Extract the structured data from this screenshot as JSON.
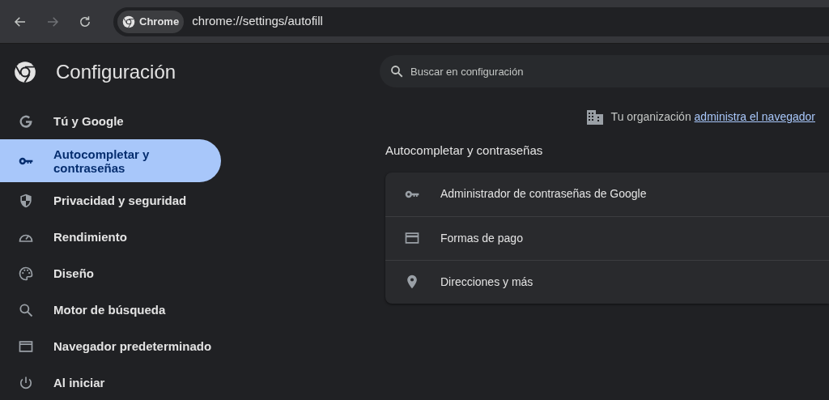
{
  "toolbar": {
    "back_disabled": false,
    "forward_disabled": true,
    "chip": "Chrome",
    "url": "chrome://settings/autofill"
  },
  "sidebar": {
    "title": "Configuración",
    "items": [
      {
        "label": "Tú y Google",
        "selected": false
      },
      {
        "label": "Autocompletar y contraseñas",
        "selected": true
      },
      {
        "label": "Privacidad y seguridad",
        "selected": false
      },
      {
        "label": "Rendimiento",
        "selected": false
      },
      {
        "label": "Diseño",
        "selected": false
      },
      {
        "label": "Motor de búsqueda",
        "selected": false
      },
      {
        "label": "Navegador predeterminado",
        "selected": false
      },
      {
        "label": "Al iniciar",
        "selected": false
      }
    ]
  },
  "search": {
    "placeholder": "Buscar en configuración"
  },
  "managed_notice": {
    "text": "Tu organización",
    "link": "administra el navegador"
  },
  "section": {
    "title": "Autocompletar y contraseñas",
    "rows": [
      {
        "label": "Administrador de contraseñas de Google"
      },
      {
        "label": "Formas de pago"
      },
      {
        "label": "Direcciones y más"
      }
    ]
  }
}
